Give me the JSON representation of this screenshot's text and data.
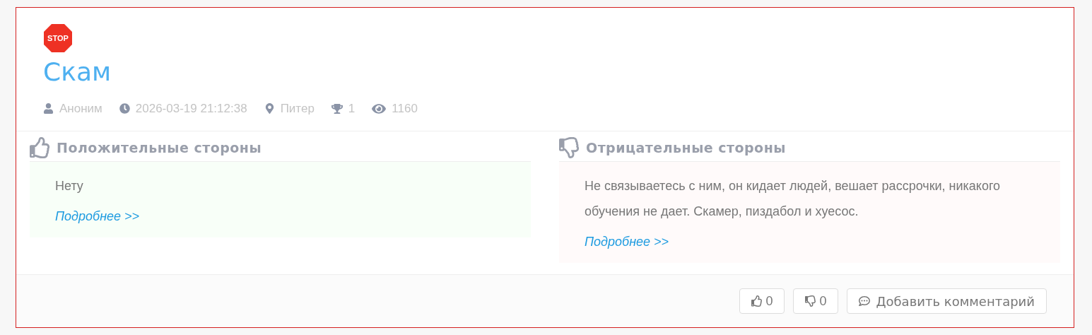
{
  "post": {
    "badge": "STOP",
    "title": "Скам",
    "meta": [
      {
        "kind": "author",
        "text": "Аноним"
      },
      {
        "kind": "date",
        "text": "2026-03-19 21:12:38"
      },
      {
        "kind": "location",
        "text": "Питер"
      },
      {
        "kind": "rating",
        "text": "1"
      },
      {
        "kind": "views",
        "text": "1160"
      }
    ]
  },
  "sections": [
    {
      "kind": "positive",
      "heading": "Положительные стороны",
      "body": "Нету",
      "more": "Подробнее >>"
    },
    {
      "kind": "negative",
      "heading": "Отрицательные стороны",
      "body": "Не связываетесь с ним, он кидает людей, вешает рассрочки, никакого обучения не дает. Скамер, пиздабол и хуесос.",
      "more": "Подробнее >>"
    }
  ],
  "footer": {
    "likes": "0",
    "dislikes": "0",
    "comment": "Добавить комментарий"
  }
}
